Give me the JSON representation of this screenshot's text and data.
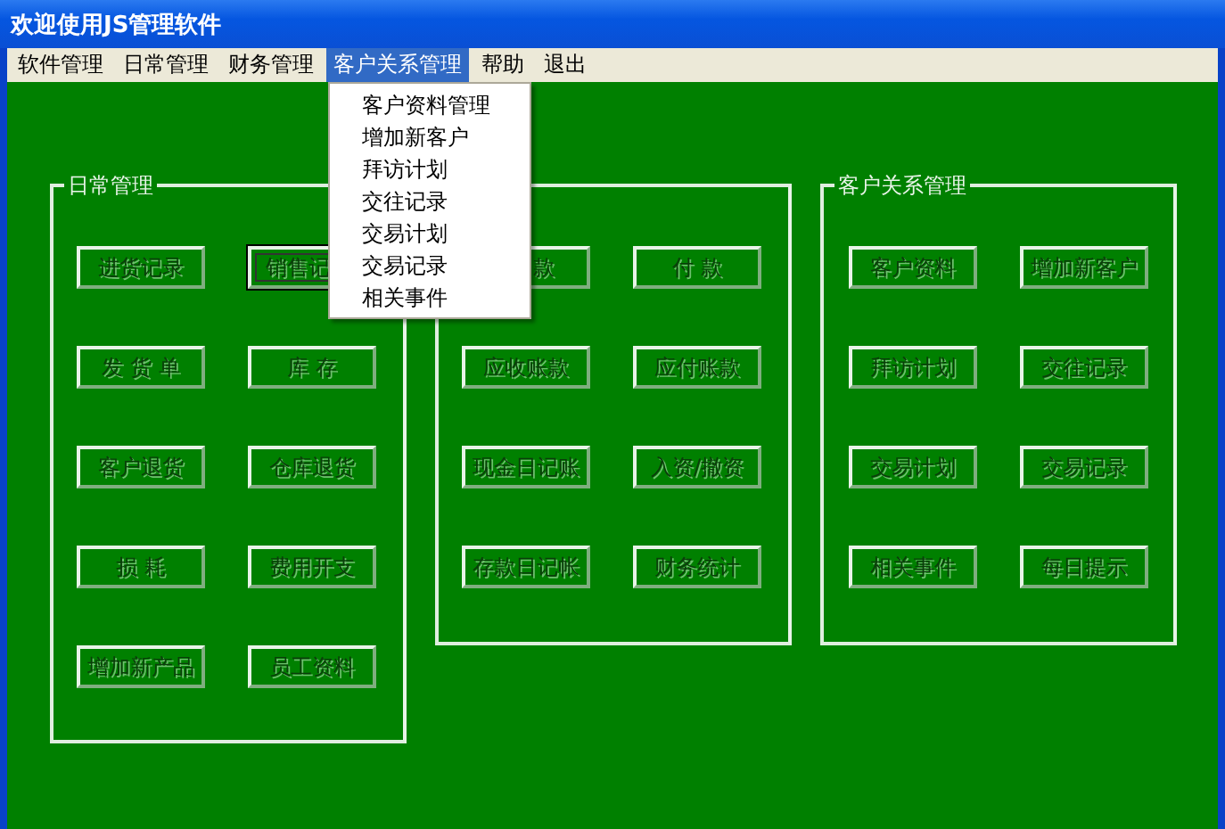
{
  "window": {
    "title": "欢迎使用JS管理软件"
  },
  "menubar": [
    {
      "label": "软件管理",
      "selected": false
    },
    {
      "label": "日常管理",
      "selected": false
    },
    {
      "label": "财务管理",
      "selected": false
    },
    {
      "label": "客户关系管理",
      "selected": true
    },
    {
      "label": "帮助",
      "selected": false
    },
    {
      "label": "退出",
      "selected": false
    }
  ],
  "open_menu": {
    "items": [
      "客户资料管理",
      "增加新客户",
      "拜访计划",
      "交往记录",
      "交易计划",
      "交易记录",
      "相关事件"
    ]
  },
  "groups": [
    {
      "title": "日常管理",
      "buttons": [
        {
          "label": "进货记录",
          "focused": false
        },
        {
          "label": "销售记",
          "focused": true,
          "partly_hidden": true
        },
        {
          "label": "发 货 单",
          "focused": false
        },
        {
          "label": "库 存",
          "focused": false
        },
        {
          "label": "客户退货",
          "focused": false
        },
        {
          "label": "仓库退货",
          "focused": false
        },
        {
          "label": "损 耗",
          "focused": false
        },
        {
          "label": "费用开支",
          "focused": false
        },
        {
          "label": "增加新产品",
          "focused": false
        },
        {
          "label": "员工资料",
          "focused": false
        }
      ]
    },
    {
      "buttons": [
        {
          "label": "款",
          "focused": false,
          "partly_hidden": true
        },
        {
          "label": "付 款",
          "focused": false
        },
        {
          "label": "应收账款",
          "focused": false
        },
        {
          "label": "应付账款",
          "focused": false
        },
        {
          "label": "现金日记账",
          "focused": false
        },
        {
          "label": "入资/撤资",
          "focused": false
        },
        {
          "label": "存款日记帐",
          "focused": false
        },
        {
          "label": "财务统计",
          "focused": false
        }
      ]
    },
    {
      "title": "客户关系管理",
      "buttons": [
        {
          "label": "客户资料",
          "focused": false
        },
        {
          "label": "增加新客户",
          "focused": false
        },
        {
          "label": "拜访计划",
          "focused": false
        },
        {
          "label": "交往记录",
          "focused": false
        },
        {
          "label": "交易计划",
          "focused": false
        },
        {
          "label": "交易记录",
          "focused": false
        },
        {
          "label": "相关事件",
          "focused": false
        },
        {
          "label": "每日提示",
          "focused": false
        }
      ]
    }
  ]
}
